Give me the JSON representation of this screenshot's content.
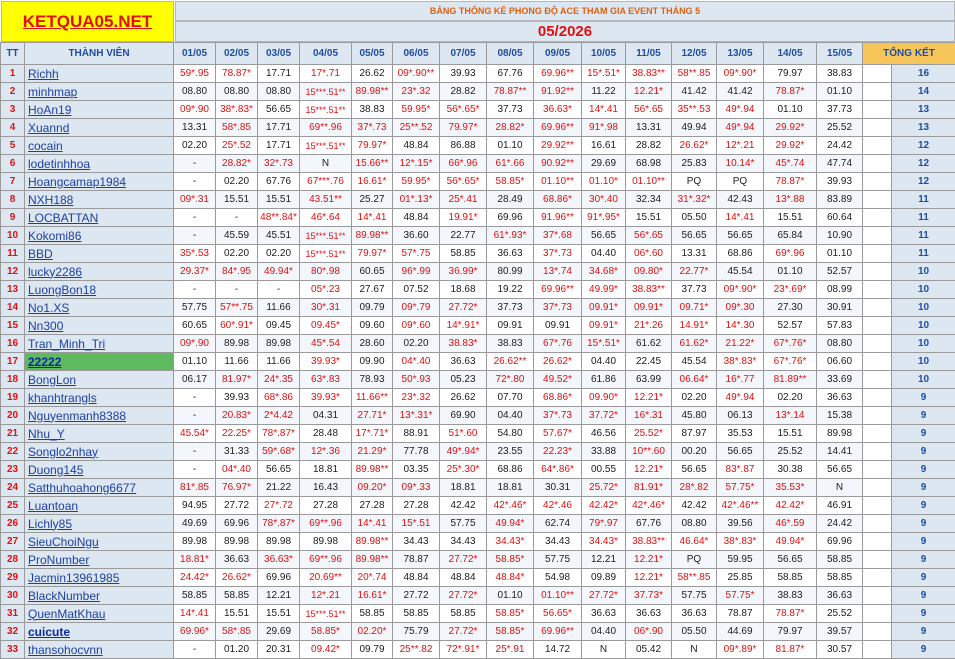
{
  "logo": "KETQUA05.NET",
  "banner": "BẢNG THỐNG KÊ PHONG ĐỘ ACE THAM GIA EVENT THÁNG 5",
  "month": "05/2026",
  "headers": {
    "tt": "TT",
    "member": "THÀNH VIÊN",
    "total": "TỔNG KẾT"
  },
  "dates": [
    "01/05",
    "02/05",
    "03/05",
    "04/05",
    "05/05",
    "06/05",
    "07/05",
    "08/05",
    "09/05",
    "10/05",
    "11/05",
    "12/05",
    "13/05",
    "14/05",
    "15/05"
  ],
  "rows": [
    {
      "tt": "1",
      "name": "Richh",
      "v": [
        "59*.95",
        "78.87*",
        "17.71",
        "17*.71",
        "26.62",
        "09*.90**",
        "39.93",
        "67.76",
        "69.96**",
        "15*.51*",
        "38.83**",
        "58**.85",
        "09*.90*",
        "79.97",
        "38.83"
      ],
      "total": "16"
    },
    {
      "tt": "2",
      "name": "minhmap",
      "v": [
        "08.80",
        "08.80",
        "08.80",
        "15***.51**",
        "89.98**",
        "23*.32",
        "28.82",
        "78.87**",
        "91.92**",
        "11.22",
        "12.21*",
        "41.42",
        "41.42",
        "78.87*",
        "01.10"
      ],
      "total": "14"
    },
    {
      "tt": "3",
      "name": "HoAn19",
      "v": [
        "09*.90",
        "38*.83*",
        "56.65",
        "15***.51**",
        "38.83",
        "59.95*",
        "56*.65*",
        "37.73",
        "36.63*",
        "14*.41",
        "56*.65",
        "35**.53",
        "49*.94",
        "01.10",
        "37.73"
      ],
      "total": "13"
    },
    {
      "tt": "4",
      "name": "Xuannd",
      "v": [
        "13.31",
        "58*.85",
        "17.71",
        "69**.96",
        "37*.73",
        "25**.52",
        "79.97*",
        "28.82*",
        "69.96**",
        "91*.98",
        "13.31",
        "49.94",
        "49*.94",
        "29.92*",
        "25.52"
      ],
      "total": "13"
    },
    {
      "tt": "5",
      "name": "cocain",
      "v": [
        "02.20",
        "25*.52",
        "17.71",
        "15***.51**",
        "79.97*",
        "48.84",
        "86.88",
        "01.10",
        "29.92**",
        "16.61",
        "28.82",
        "26.62*",
        "12*.21",
        "29.92*",
        "24.42"
      ],
      "total": "12"
    },
    {
      "tt": "6",
      "name": "lodetinhhoa",
      "v": [
        "-",
        "28.82*",
        "32*.73",
        "N",
        "15.66**",
        "12*.15*",
        "66*.96",
        "61*.66",
        "90.92**",
        "29.69",
        "68.98",
        "25.83",
        "10.14*",
        "45*.74",
        "47.74"
      ],
      "total": "12"
    },
    {
      "tt": "7",
      "name": "Hoangcamap1984",
      "v": [
        "-",
        "02.20",
        "67.76",
        "67***.76",
        "16.61*",
        "59.95*",
        "56*.65*",
        "58.85*",
        "01.10**",
        "01.10*",
        "01.10**",
        "PQ",
        "PQ",
        "78.87*",
        "39.93"
      ],
      "total": "12"
    },
    {
      "tt": "8",
      "name": "NXH188",
      "v": [
        "09*.31",
        "15.51",
        "15.51",
        "43.51**",
        "25.27",
        "01*.13*",
        "25*.41",
        "28.49",
        "68.86*",
        "30*.40",
        "32.34",
        "31*.32*",
        "42.43",
        "13*.88",
        "83.89"
      ],
      "total": "11"
    },
    {
      "tt": "9",
      "name": "LOCBATTAN",
      "v": [
        "-",
        "-",
        "48**.84*",
        "46*.64",
        "14*.41",
        "48.84",
        "19.91*",
        "69.96",
        "91.96**",
        "91*.95*",
        "15.51",
        "05.50",
        "14*.41",
        "15.51",
        "60.64"
      ],
      "total": "11"
    },
    {
      "tt": "10",
      "name": "Kokomi86",
      "v": [
        "-",
        "45.59",
        "45.51",
        "15***.51**",
        "89.98**",
        "36.60",
        "22.77",
        "61*.93*",
        "37*.68",
        "56.65",
        "56*.65",
        "56.65",
        "56.65",
        "65.84",
        "10.90"
      ],
      "total": "11"
    },
    {
      "tt": "11",
      "name": "BBD",
      "v": [
        "35*.53",
        "02.20",
        "02.20",
        "15***.51**",
        "79.97*",
        "57*.75",
        "58.85",
        "36.63",
        "37*.73",
        "04.40",
        "06*.60",
        "13.31",
        "68.86",
        "69*.96",
        "01.10"
      ],
      "total": "11"
    },
    {
      "tt": "12",
      "name": "lucky2286",
      "v": [
        "29.37*",
        "84*.95",
        "49.94*",
        "80*.98",
        "60.65",
        "96*.99",
        "36.99*",
        "80.99",
        "13*.74",
        "34.68*",
        "09.80*",
        "22.77*",
        "45.54",
        "01.10",
        "52.57"
      ],
      "total": "10"
    },
    {
      "tt": "13",
      "name": "LuongBon18",
      "v": [
        "-",
        "-",
        "-",
        "05*.23",
        "27.67",
        "07.52",
        "18.68",
        "19.22",
        "69.96**",
        "49.99*",
        "38.83**",
        "37.73",
        "09*.90*",
        "23*.69*",
        "08.99"
      ],
      "total": "10"
    },
    {
      "tt": "14",
      "name": "No1.XS",
      "v": [
        "57.75",
        "57**.75",
        "11.66",
        "30*.31",
        "09.79",
        "09*.79",
        "27.72*",
        "37.73",
        "37*.73",
        "09.91*",
        "09.91*",
        "09.71*",
        "09*.30",
        "27.30",
        "30.91"
      ],
      "total": "10"
    },
    {
      "tt": "15",
      "name": "Nn300",
      "v": [
        "60.65",
        "60*.91*",
        "09.45",
        "09.45*",
        "09.60",
        "09*.60",
        "14*.91*",
        "09.91",
        "09.91",
        "09.91*",
        "21*.26",
        "14.91*",
        "14*.30",
        "52.57",
        "57.83"
      ],
      "total": "10"
    },
    {
      "tt": "16",
      "name": "Tran_Minh_Tri",
      "v": [
        "09*.90",
        "89.98",
        "89.98",
        "45*.54",
        "28.60",
        "02.20",
        "38.83*",
        "38.83",
        "67*.76",
        "15*.51*",
        "61.62",
        "61.62*",
        "21.22*",
        "67*.76*",
        "08.80"
      ],
      "total": "10"
    },
    {
      "tt": "17",
      "name": "22222",
      "v": [
        "01.10",
        "11.66",
        "11.66",
        "39.93*",
        "09.90",
        "04*.40",
        "36.63",
        "26.62**",
        "26.62*",
        "04.40",
        "22.45",
        "45.54",
        "38*.83*",
        "67*.76*",
        "06.60"
      ],
      "total": "10"
    },
    {
      "tt": "18",
      "name": "BongLon",
      "v": [
        "06.17",
        "81.97*",
        "24*.35",
        "63*.83",
        "78.93",
        "50*.93",
        "05.23",
        "72*.80",
        "49.52*",
        "61.86",
        "63.99",
        "06.64*",
        "16*.77",
        "81.89**",
        "33.69"
      ],
      "total": "10"
    },
    {
      "tt": "19",
      "name": "khanhtrangls",
      "v": [
        "-",
        "39.93",
        "68*.86",
        "39.93*",
        "11.66**",
        "23*.32",
        "26.62",
        "07.70",
        "68.86*",
        "09.90*",
        "12.21*",
        "02.20",
        "49*.94",
        "02.20",
        "36.63"
      ],
      "total": "9"
    },
    {
      "tt": "20",
      "name": "Nguyenmanh8388",
      "v": [
        "-",
        "20.83*",
        "2*4.42",
        "04.31",
        "27.71*",
        "13*.31*",
        "69.90",
        "04.40",
        "37*.73",
        "37.72*",
        "16*.31",
        "45.80",
        "06.13",
        "13*.14",
        "15.38"
      ],
      "total": "9"
    },
    {
      "tt": "21",
      "name": "Nhu_Y",
      "v": [
        "45.54*",
        "22.25*",
        "78*.87*",
        "28.48",
        "17*.71*",
        "88.91",
        "51*.60",
        "54.80",
        "57.67*",
        "46.56",
        "25.52*",
        "87.97",
        "35.53",
        "15.51",
        "89.98"
      ],
      "total": "9"
    },
    {
      "tt": "22",
      "name": "Songlo2nhay",
      "v": [
        "-",
        "31.33",
        "59*.68*",
        "12*.36",
        "21.29*",
        "77.78",
        "49*.94*",
        "23.55",
        "22.23*",
        "33.88",
        "10**.60",
        "00.20",
        "56.65",
        "25.52",
        "14.41"
      ],
      "total": "9"
    },
    {
      "tt": "23",
      "name": "Duong145",
      "v": [
        "-",
        "04*.40",
        "56.65",
        "18.81",
        "89.98**",
        "03.35",
        "25*.30*",
        "68.86",
        "64*.86*",
        "00.55",
        "12.21*",
        "56.65",
        "83*.87",
        "30.38",
        "56.65"
      ],
      "total": "9"
    },
    {
      "tt": "24",
      "name": "Satthuhoahong6677",
      "v": [
        "81*.85",
        "76.97*",
        "21.22",
        "16.43",
        "09.20*",
        "09*.33",
        "18.81",
        "18.81",
        "30.31",
        "25.72*",
        "81.91*",
        "28*.82",
        "57.75*",
        "35.53*",
        "N"
      ],
      "total": "9"
    },
    {
      "tt": "25",
      "name": "Luantoan",
      "v": [
        "94.95",
        "27.72",
        "27*.72",
        "27.28",
        "27.28",
        "27.28",
        "42.42",
        "42*.46*",
        "42*.46",
        "42.42*",
        "42*.46*",
        "42.42",
        "42*.46**",
        "42.42*",
        "46.91"
      ],
      "total": "9"
    },
    {
      "tt": "26",
      "name": "Lichly85",
      "v": [
        "49.69",
        "69.96",
        "78*.87*",
        "69**.96",
        "14*.41",
        "15*.51",
        "57.75",
        "49.94*",
        "62.74",
        "79*.97",
        "67.76",
        "08.80",
        "39.56",
        "46*.59",
        "24.42"
      ],
      "total": "9"
    },
    {
      "tt": "27",
      "name": "SieuChoiNgu",
      "v": [
        "89.98",
        "89.98",
        "89.98",
        "89.98",
        "89.98**",
        "34.43",
        "34.43",
        "34.43*",
        "34.43",
        "34.43*",
        "38.83**",
        "46.64*",
        "38*.83*",
        "49.94*",
        "69.96"
      ],
      "total": "9"
    },
    {
      "tt": "28",
      "name": "ProNumber",
      "v": [
        "18.81*",
        "36.63",
        "36.63*",
        "69**.96",
        "89.98**",
        "78.87",
        "27.72*",
        "58.85*",
        "57.75",
        "12.21",
        "12.21*",
        "PQ",
        "59.95",
        "56.65",
        "58.85"
      ],
      "total": "9"
    },
    {
      "tt": "29",
      "name": "Jacmin13961985",
      "v": [
        "24.42*",
        "26.62*",
        "69.96",
        "20.69**",
        "20*.74",
        "48.84",
        "48.84",
        "48.84*",
        "54.98",
        "09.89",
        "12.21*",
        "58**.85",
        "25.85",
        "58.85",
        "58.85"
      ],
      "total": "9"
    },
    {
      "tt": "30",
      "name": "BlackNumber",
      "v": [
        "58.85",
        "58.85",
        "12.21",
        "12*.21",
        "16.61*",
        "27.72",
        "27.72*",
        "01.10",
        "01.10**",
        "27.72*",
        "37.73*",
        "57.75",
        "57.75*",
        "38.83",
        "36.63"
      ],
      "total": "9"
    },
    {
      "tt": "31",
      "name": "QuenMatKhau",
      "v": [
        "14*.41",
        "15.51",
        "15.51",
        "15***.51**",
        "58.85",
        "58.85",
        "58.85",
        "58.85*",
        "56.65*",
        "36.63",
        "36.63",
        "36.63",
        "78.87",
        "78.87*",
        "25.52"
      ],
      "total": "9"
    },
    {
      "tt": "32",
      "name": "cuicute",
      "v": [
        "69.96*",
        "58*.85",
        "29.69",
        "58.85*",
        "02.20*",
        "75.79",
        "27.72*",
        "58.85*",
        "69.96**",
        "04.40",
        "06*.90",
        "05.50",
        "44.69",
        "79.97",
        "39.57"
      ],
      "total": "9"
    },
    {
      "tt": "33",
      "name": "thansohocvnn",
      "v": [
        "-",
        "01.20",
        "20.31",
        "09.42*",
        "09.79",
        "25**.82",
        "72*.91*",
        "25*.91",
        "14.72",
        "N",
        "05.42",
        "N",
        "09*.89*",
        "81.87*",
        "30.57"
      ],
      "total": "9"
    }
  ],
  "colors": {
    "header_bg": "#dde7f2",
    "logo_bg": "#ffff00",
    "total_header": "#f7c65a",
    "highlight": "#5fb95f",
    "red": "#e01010",
    "blue": "#1f4ea0"
  }
}
